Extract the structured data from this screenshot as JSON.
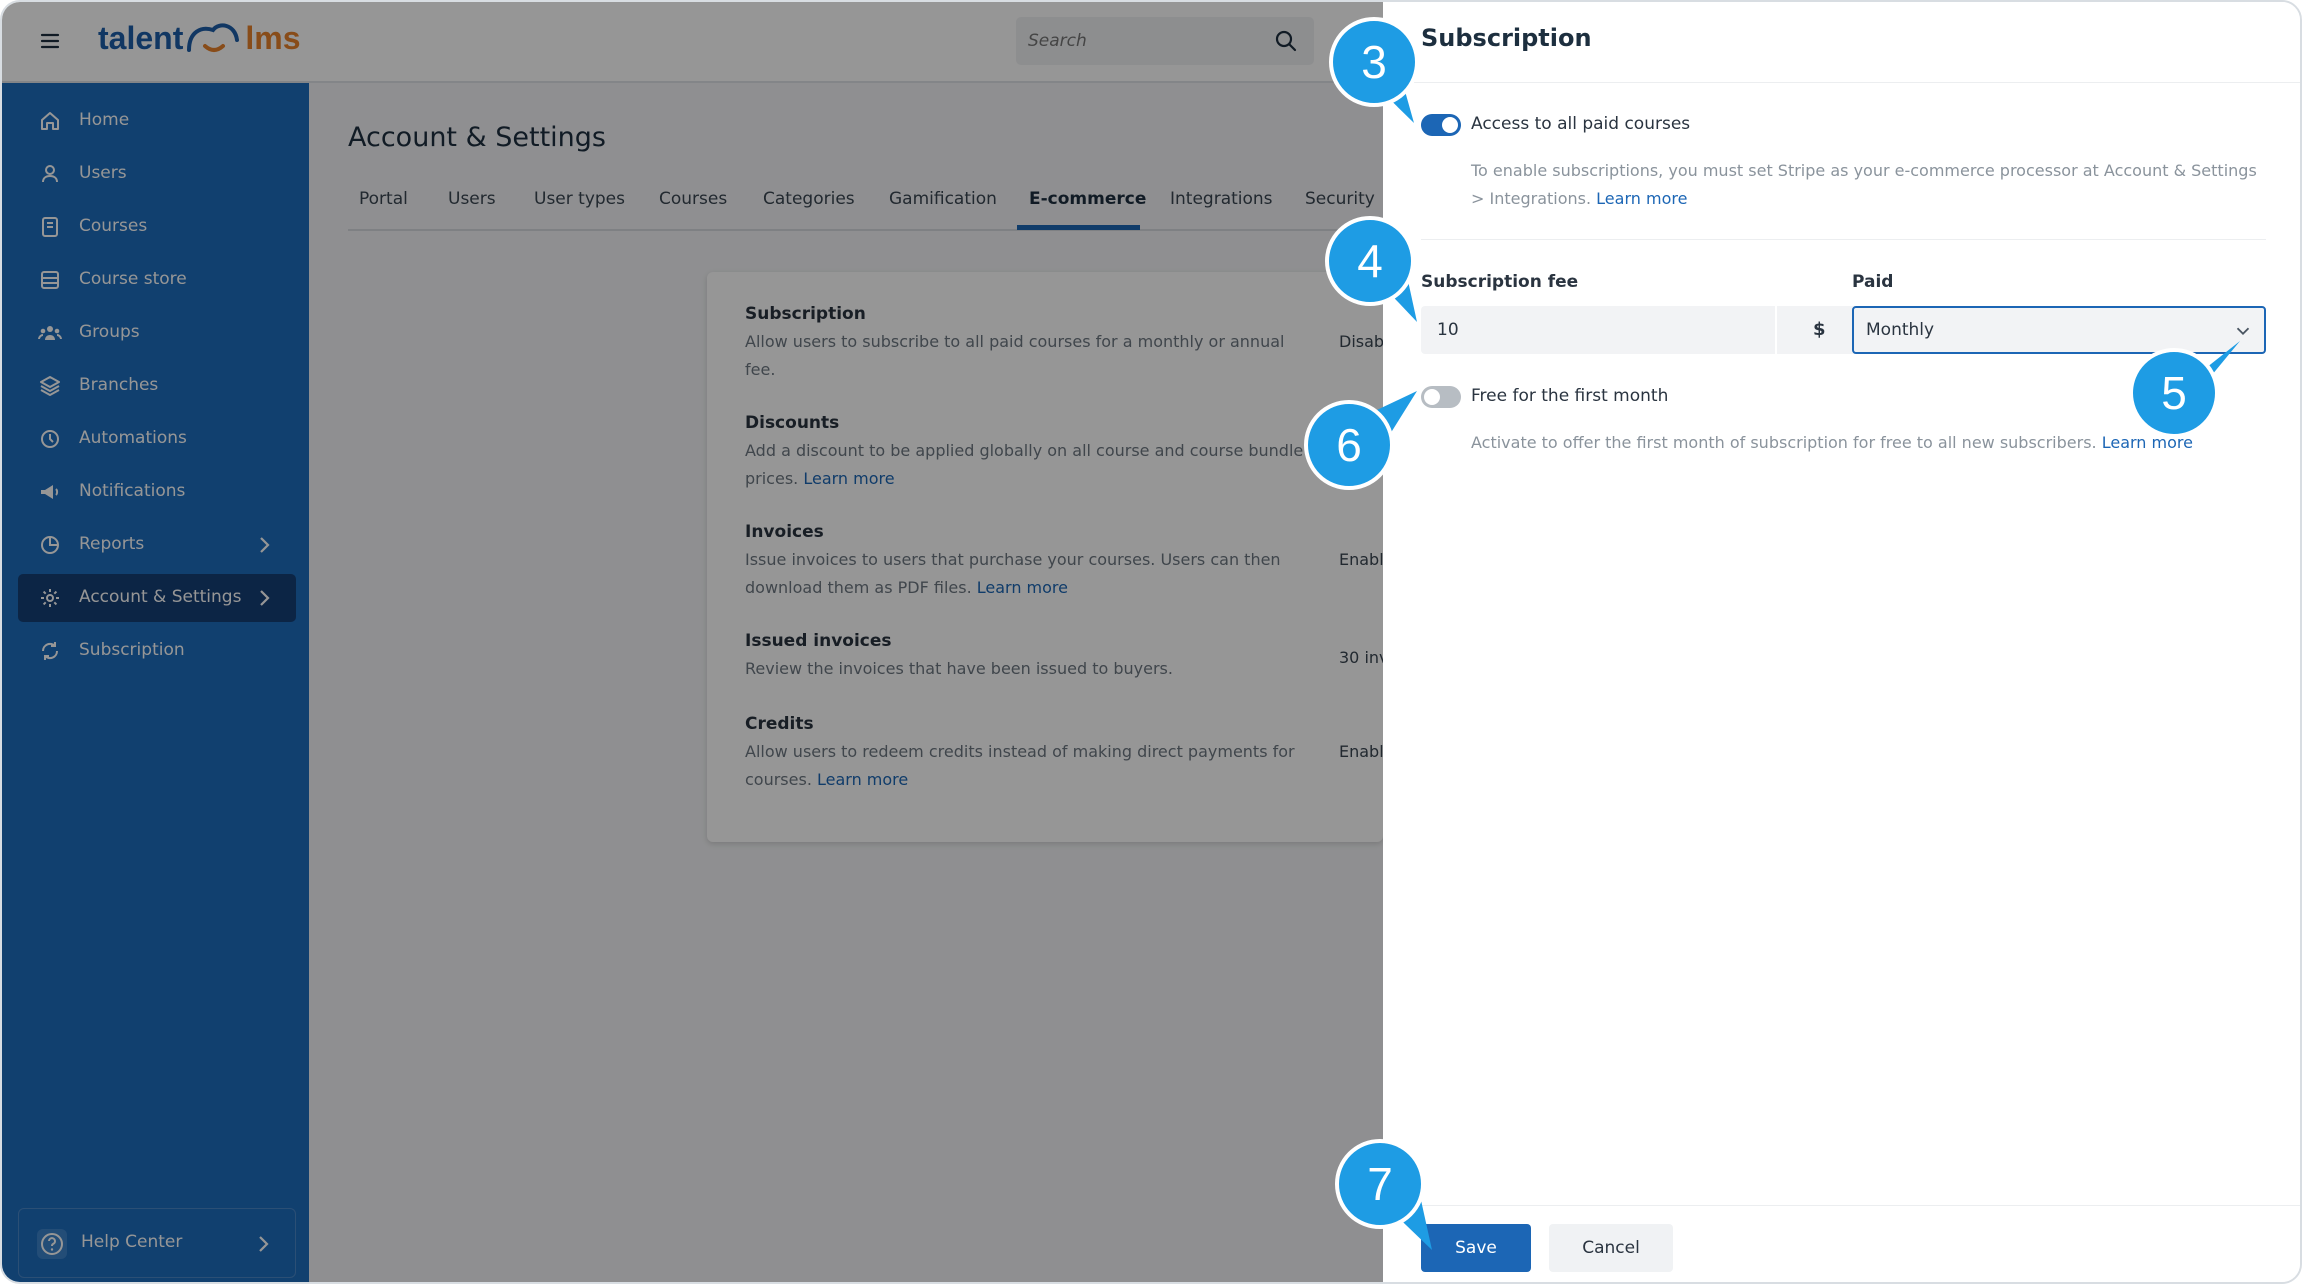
{
  "topbar": {
    "logo_left": "talent",
    "logo_right": "lms",
    "search_placeholder": "Search"
  },
  "sidebar": {
    "items": [
      {
        "label": "Home",
        "icon": "home-icon"
      },
      {
        "label": "Users",
        "icon": "user-icon"
      },
      {
        "label": "Courses",
        "icon": "book-icon"
      },
      {
        "label": "Course store",
        "icon": "store-icon"
      },
      {
        "label": "Groups",
        "icon": "groups-icon"
      },
      {
        "label": "Branches",
        "icon": "layers-icon"
      },
      {
        "label": "Automations",
        "icon": "automation-icon"
      },
      {
        "label": "Notifications",
        "icon": "megaphone-icon"
      },
      {
        "label": "Reports",
        "icon": "pie-chart-icon"
      },
      {
        "label": "Account & Settings",
        "icon": "gear-icon"
      },
      {
        "label": "Subscription",
        "icon": "subscription-icon"
      }
    ],
    "help_label": "Help Center"
  },
  "main": {
    "title": "Account & Settings",
    "tabs": [
      "Portal",
      "Users",
      "User types",
      "Courses",
      "Categories",
      "Gamification",
      "E-commerce",
      "Integrations",
      "Security"
    ],
    "active_tab": "E-commerce",
    "settings": [
      {
        "title": "Subscription",
        "desc": "Allow users to subscribe to all paid courses for a monthly or annual fee.",
        "link": "",
        "value": "Disab"
      },
      {
        "title": "Discounts",
        "desc": "Add a discount to be applied globally on all course and course bundle prices.",
        "link": "Learn more",
        "value": ""
      },
      {
        "title": "Invoices",
        "desc": "Issue invoices to users that purchase your courses. Users can then download them as PDF files.",
        "link": "Learn more",
        "value": "Enabl"
      },
      {
        "title": "Issued invoices",
        "desc": "Review the invoices that have been issued to buyers.",
        "link": "",
        "value": "30 inv"
      },
      {
        "title": "Credits",
        "desc": "Allow users to redeem credits instead of making direct payments for courses.",
        "link": "Learn more",
        "value": "Enabl"
      }
    ]
  },
  "panel": {
    "title": "Subscription",
    "access_label": "Access to all paid courses",
    "access_enabled": true,
    "access_help": "To enable subscriptions, you must set Stripe as your e-commerce processor at Account & Settings > Integrations.",
    "access_link": "Learn more",
    "fee_label": "Subscription fee",
    "fee_value": "10",
    "currency": "$",
    "paid_label": "Paid",
    "paid_value": "Monthly",
    "free_label": "Free for the first month",
    "free_enabled": false,
    "free_help": "Activate to offer the first month of subscription for free to all new subscribers.",
    "free_link": "Learn more",
    "save_label": "Save",
    "cancel_label": "Cancel"
  },
  "callouts": [
    "3",
    "4",
    "5",
    "6",
    "7"
  ],
  "colors": {
    "sidebar": "#1d6dbd",
    "sidebar_active": "#163f76",
    "primary_button": "#1c66b5",
    "callout": "#1e9ce4",
    "logo_blue": "#1d5ea8",
    "logo_orange": "#e8822b"
  }
}
